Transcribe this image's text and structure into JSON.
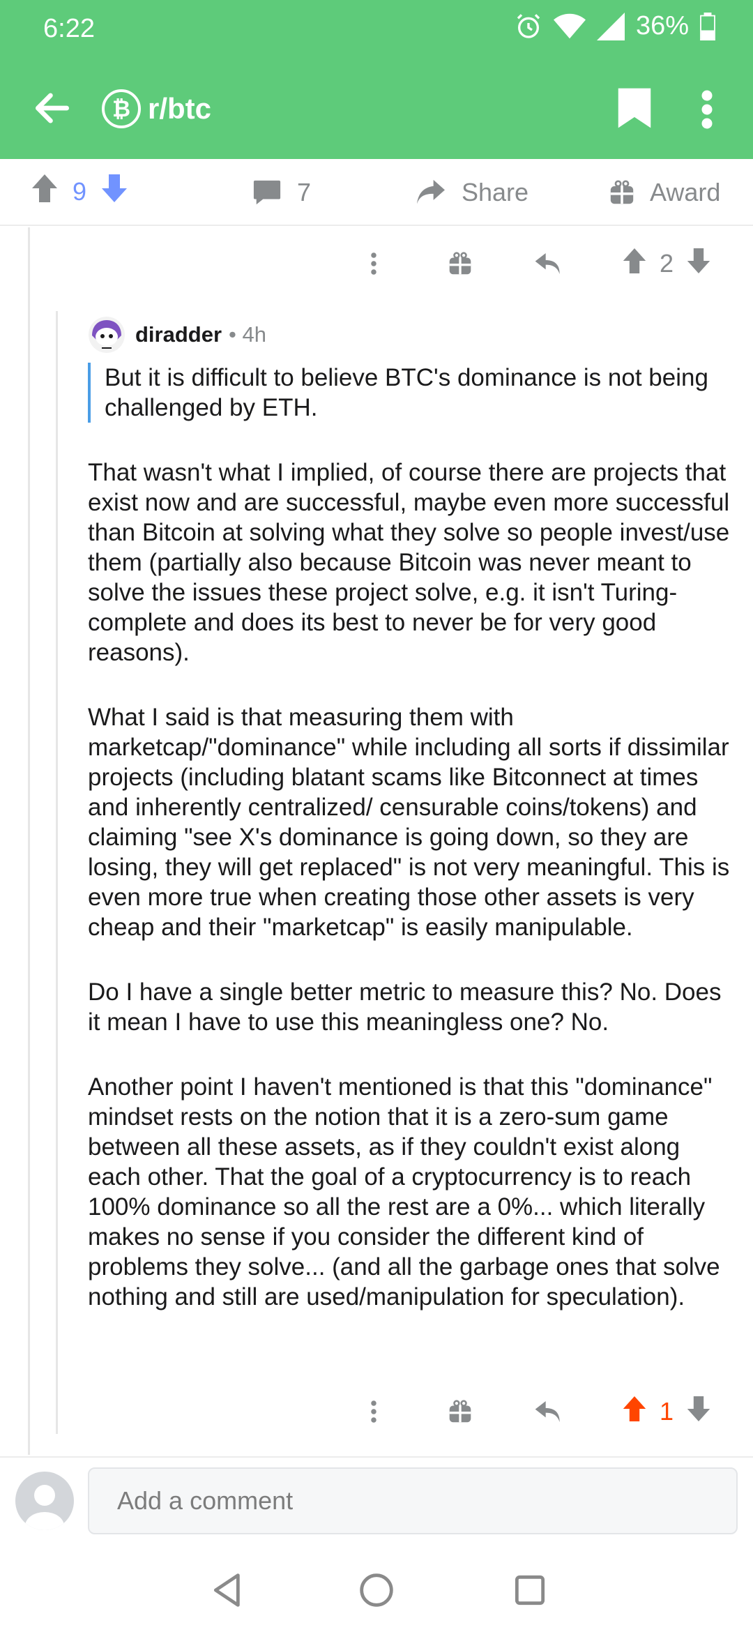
{
  "status_bar": {
    "time": "6:22",
    "battery": "36%"
  },
  "app_bar": {
    "subreddit": "r/btc",
    "sub_icon_glyph": "₿"
  },
  "post_actions": {
    "score": "9",
    "comments": "7",
    "share_label": "Share",
    "award_label": "Award"
  },
  "parent_comment": {
    "score": "2"
  },
  "comment": {
    "author": "diradder",
    "age": "• 4h",
    "quote": "But it is difficult to believe BTC's dominance is not being challenged by ETH.",
    "paragraphs": [
      "That wasn't what I implied, of course there are projects that exist now and are successful, maybe even more successful than Bitcoin at solving what they solve so people invest/use them (partially also because Bitcoin was never meant to solve the issues these project solve, e.g. it isn't Turing-complete and does its best to never be for very good reasons).",
      "What I said is that measuring them with marketcap/\"dominance\" while including all sorts if dissimilar projects (including blatant scams like Bitconnect at times and inherently centralized/ censurable coins/tokens) and claiming \"see X's dominance is going down, so they are losing, they will get replaced\" is not very meaningful. This is even more true when creating those other assets is very cheap and their \"marketcap\" is easily manipulable.",
      "Do I have a single better metric to measure this? No. Does it mean I have to use this meaningless one? No.",
      "Another point I haven't mentioned is that this \"dominance\" mindset rests on the notion that it is a zero-sum game between all these assets, as if they couldn't exist along each other. That the goal of a cryptocurrency is to reach 100% dominance so all the rest are a 0%... which literally makes no sense if you consider the different kind of problems they solve... (and all the garbage ones that solve nothing and still are used/manipulation for speculation)."
    ],
    "score": "1"
  },
  "composer": {
    "placeholder": "Add a comment"
  },
  "colors": {
    "header": "#5ecb7a",
    "upvote_active": "#ff4500",
    "downvote_active": "#7193ff",
    "quote_bar": "#4a9de6"
  }
}
